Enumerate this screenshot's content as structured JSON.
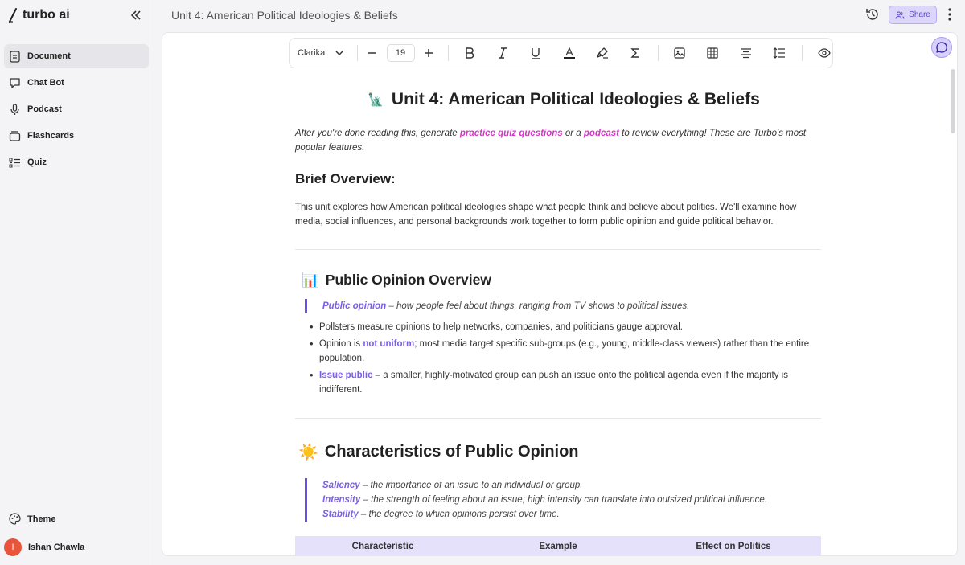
{
  "app": {
    "name": "turbo ai"
  },
  "sidebar": {
    "items": [
      {
        "label": "Document",
        "icon": "document-icon",
        "active": true
      },
      {
        "label": "Chat Bot",
        "icon": "chat-icon"
      },
      {
        "label": "Podcast",
        "icon": "microphone-icon"
      },
      {
        "label": "Flashcards",
        "icon": "flashcards-icon"
      },
      {
        "label": "Quiz",
        "icon": "list-icon"
      }
    ],
    "theme_label": "Theme",
    "user": {
      "name": "Ishan Chawla",
      "initial": "I"
    }
  },
  "header": {
    "title": "Unit 4: American Political Ideologies & Beliefs",
    "share_label": "Share"
  },
  "toolbar": {
    "font": "Clarika",
    "font_size": "19",
    "minus": "−",
    "plus": "+"
  },
  "document": {
    "title": "Unit 4: American Political Ideologies & Beliefs",
    "title_icon": "🗽",
    "intro": {
      "before": "After you're done reading this, generate ",
      "link1": "practice quiz questions",
      "middle": " or a ",
      "link2": "podcast",
      "after": " to review everything! These are Turbo's most popular features."
    },
    "overview_heading": "Brief Overview:",
    "overview_text": "This unit explores how American political ideologies shape what people think and believe about politics. We'll examine how media, social influences, and personal backgrounds work together to form public opinion and guide political behavior.",
    "section1": {
      "icon": "📊",
      "heading": "Public Opinion Overview",
      "quote_term": "Public opinion",
      "quote_text": " – how people feel about things, ranging from TV shows to political issues.",
      "bullet1": "Pollsters measure opinions to help networks, companies, and politicians gauge approval.",
      "bullet2_before": "Opinion is ",
      "bullet2_term": "not uniform",
      "bullet2_after": "; most media target specific sub-groups (e.g., young, middle-class viewers) rather than the entire population.",
      "bullet3_term": "Issue public",
      "bullet3_after": " – a smaller, highly-motivated group can push an issue onto the political agenda even if the majority is indifferent."
    },
    "section2": {
      "icon": "☀️",
      "heading": "Characteristics of Public Opinion",
      "q1_term": "Saliency",
      "q1_text": " – the importance of an issue to an individual or group.",
      "q2_term": "Intensity",
      "q2_text": " – the strength of feeling about an issue; high intensity can translate into outsized political influence.",
      "q3_term": "Stability",
      "q3_text": " – the degree to which opinions persist over time.",
      "table_headers": [
        "Characteristic",
        "Example",
        "Effect on Politics"
      ]
    }
  }
}
